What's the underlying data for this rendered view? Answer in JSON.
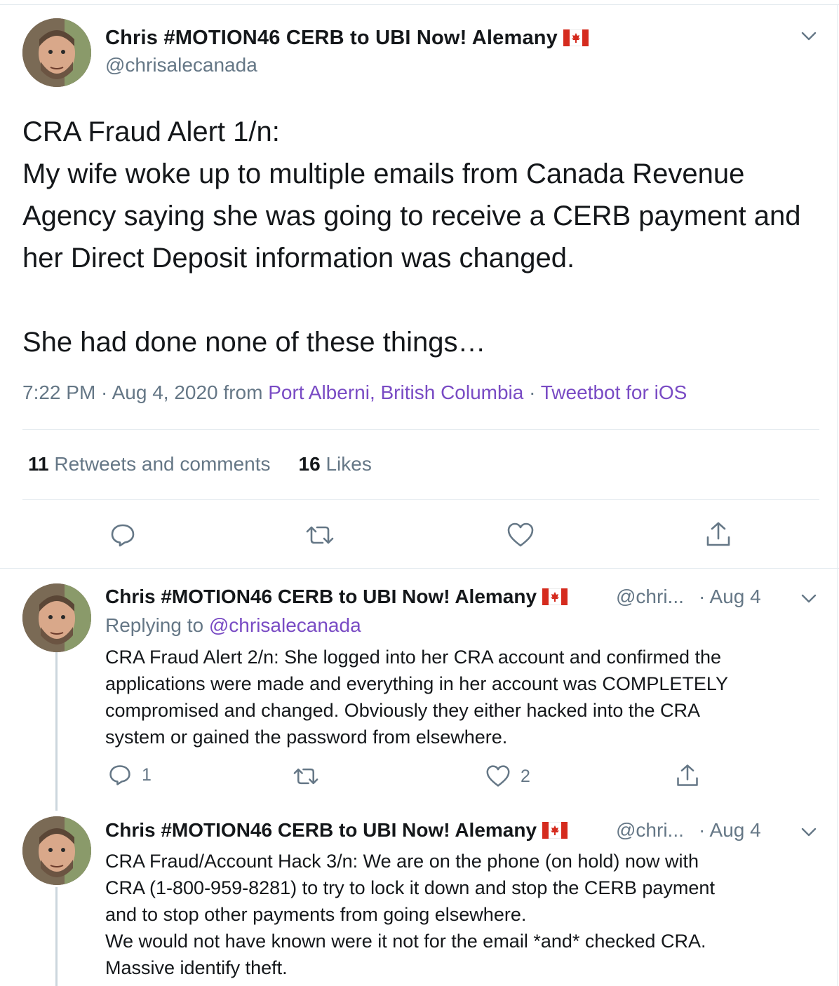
{
  "main_tweet": {
    "author_name": "Chris #MOTION46 CERB to UBI Now! Alemany",
    "handle": "@chrisalecanada",
    "text": "CRA Fraud Alert 1/n:\nMy wife woke up to multiple emails from Canada Revenue Agency saying she was going to receive a CERB payment and her Direct Deposit information was changed.\n\nShe had done none of these things…",
    "time": "7:22 PM · Aug 4, 2020 from ",
    "location": "Port Alberni, British Columbia",
    "separator": " · ",
    "source": "Tweetbot for iOS",
    "retweets_count": "11",
    "retweets_label": " Retweets and comments",
    "likes_count": "16",
    "likes_label": " Likes"
  },
  "replies": [
    {
      "author_name": "Chris #MOTION46 CERB to UBI Now! Alemany",
      "handle": "@chri...",
      "date": "· Aug 4",
      "replying_label": "Replying to ",
      "replying_handle": "@chrisalecanada",
      "text": "CRA Fraud Alert 2/n: She logged into her CRA account and confirmed the\napplications were made and everything in her account was COMPLETELY\ncompromised and changed. Obviously they either hacked into the CRA\nsystem or gained the password from elsewhere.",
      "reply_count": "1",
      "retweet_count": "",
      "like_count": "2"
    },
    {
      "author_name": "Chris #MOTION46 CERB to UBI Now! Alemany",
      "handle": "@chri...",
      "date": "· Aug 4",
      "text": "CRA Fraud/Account Hack 3/n: We are on the phone (on hold) now with\nCRA (1-800-959-8281) to try to lock it down and stop the CERB payment\nand to stop other payments from going elsewhere.\nWe would not have known were it not for the email *and* checked CRA.\nMassive identify theft."
    }
  ],
  "icons": {
    "reply": "comment-bubble-icon",
    "retweet": "retweet-icon",
    "like": "heart-icon",
    "share": "share-upload-icon",
    "menu": "chevron-down-icon",
    "flag": "canada-flag-icon"
  },
  "colors": {
    "text": "#14171a",
    "secondary": "#657786",
    "link": "#794bc4",
    "divider": "#e6ecf0",
    "thread_line": "#ccd6dd",
    "flag_red": "#d52b1e"
  }
}
